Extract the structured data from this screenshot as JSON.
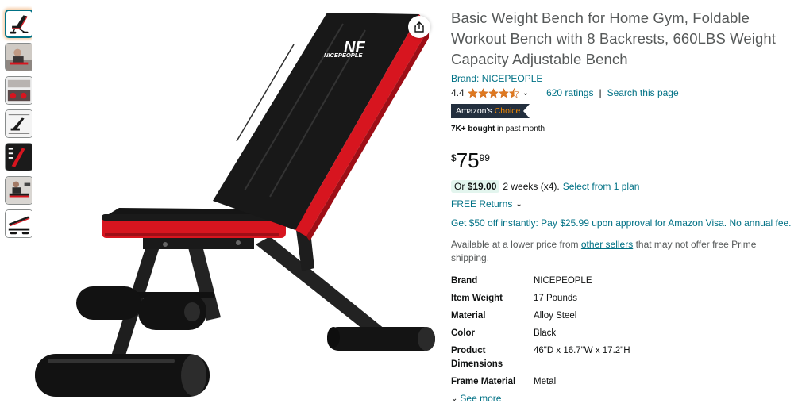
{
  "product": {
    "title": "Basic Weight Bench for Home Gym, Foldable Workout Bench with 8 Backrests, 660LBS Weight Capacity Adjustable Bench",
    "brand_link": "Brand: NICEPEOPLE",
    "rating": "4.4",
    "stars_filled": 4.4,
    "ratings_count": "620 ratings",
    "separator": "|",
    "search_page": "Search this page",
    "choice_label_1": "Amazon's",
    "choice_label_2": "Choice",
    "bought_bold": "7K+ bought",
    "bought_rest": " in past month",
    "logo_text": "NICEPEOPLE",
    "logo_mark": "NF"
  },
  "price": {
    "symbol": "$",
    "whole": "75",
    "fraction": "99"
  },
  "plan": {
    "or_label": "Or ",
    "amount": "$19.00",
    "details": " 2 weeks (x4).",
    "link": "Select from 1 plan"
  },
  "returns": {
    "label": "FREE Returns"
  },
  "promo": {
    "text": "Get $50 off instantly: Pay $25.99 upon approval for Amazon Visa. No annual fee."
  },
  "lower_price": {
    "before": "Available at a lower price from ",
    "link": "other sellers",
    "after": " that may not offer free Prime shipping."
  },
  "specs": [
    {
      "key": "Brand",
      "value": "NICEPEOPLE"
    },
    {
      "key": "Item Weight",
      "value": "17 Pounds"
    },
    {
      "key": "Material",
      "value": "Alloy Steel"
    },
    {
      "key": "Color",
      "value": "Black"
    },
    {
      "key": "Product Dimensions",
      "value": "46\"D x 16.7\"W x 17.2\"H"
    },
    {
      "key": "Frame Material",
      "value": "Metal"
    }
  ],
  "see_more": "See more",
  "colors": {
    "link": "#007185",
    "title": "#565959",
    "star": "#de7921",
    "bench_red": "#d7151f",
    "bench_black": "#1a1a1a"
  }
}
